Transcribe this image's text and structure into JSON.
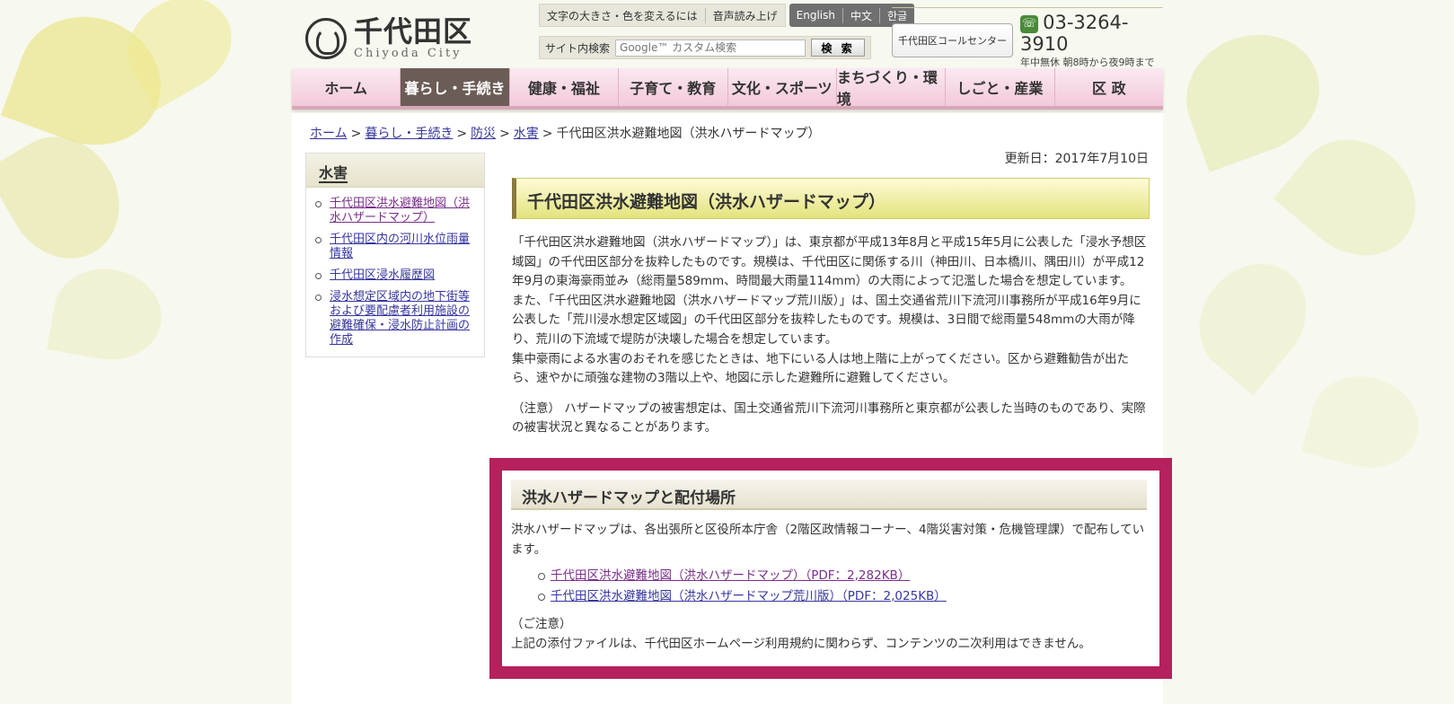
{
  "header": {
    "logo_name": "千代田区",
    "logo_sub": "Chiyoda City",
    "util_font": "文字の大きさ・色を変えるには",
    "util_voice": "音声読み上げ",
    "lang_en": "English",
    "lang_zh": "中文",
    "lang_ko": "한글",
    "search_label": "サイト内検索",
    "search_placeholder": "Google™ カスタム検索",
    "search_button": "検 索",
    "call_center": "千代田区コールセンター",
    "call_number": "03-3264-3910",
    "call_note": "年中無休  朝8時から夜9時まで"
  },
  "nav": {
    "items": [
      "ホーム",
      "暮らし・手続き",
      "健康・福祉",
      "子育て・教育",
      "文化・スポーツ",
      "まちづくり・環境",
      "しごと・産業",
      "区 政"
    ]
  },
  "breadcrumb": {
    "items": [
      "ホーム",
      "暮らし・手続き",
      "防災",
      "水害"
    ],
    "current": "千代田区洪水避難地図（洪水ハザードマップ）"
  },
  "sidebar": {
    "title": "水害",
    "items": [
      "千代田区洪水避難地図（洪水ハザードマップ）",
      "千代田区内の河川水位雨量情報",
      "千代田区浸水履歴図",
      "浸水想定区域内の地下街等および要配慮者利用施設の避難確保・浸水防止計画の作成"
    ]
  },
  "main": {
    "updated": "更新日：2017年7月10日",
    "title": "千代田区洪水避難地図（洪水ハザードマップ）",
    "paragraphs": [
      "「千代田区洪水避難地図（洪水ハザードマップ）」は、東京都が平成13年8月と平成15年5月に公表した「浸水予想区域図」の千代田区部分を抜粋したものです。規模は、千代田区に関係する川（神田川、日本橋川、隅田川）が平成12年9月の東海豪雨並み（総雨量589mm、時間最大雨量114mm）の大雨によって氾濫した場合を想定しています。",
      "また、「千代田区洪水避難地図（洪水ハザードマップ荒川版）」は、国土交通省荒川下流河川事務所が平成16年9月に公表した「荒川浸水想定区域図」の千代田区部分を抜粋したものです。規模は、3日間で総雨量548mmの大雨が降り、荒川の下流域で堤防が決壊した場合を想定しています。",
      "集中豪雨による水害のおそれを感じたときは、地下にいる人は地上階に上がってください。区から避難勧告が出たら、速やかに頑強な建物の3階以上や、地図に示した避難所に避難してください。"
    ],
    "note": "（注意） ハザードマップの被害想定は、国土交通省荒川下流河川事務所と東京都が公表した当時のものであり、実際の被害状況と異なることがあります。"
  },
  "section": {
    "title": "洪水ハザードマップと配付場所",
    "text": "洪水ハザードマップは、各出張所と区役所本庁舎（2階区政情報コーナー、4階災害対策・危機管理課）で配布しています。",
    "files": [
      "千代田区洪水避難地図（洪水ハザードマップ）（PDF：2,282KB）",
      "千代田区洪水避難地図（洪水ハザードマップ荒川版）（PDF：2,025KB）"
    ],
    "caution_title": "（ご注意）",
    "caution_text": "上記の添付ファイルは、千代田区ホームページ利用規約に関わらず、コンテンツの二次利用はできません。"
  },
  "colors": {
    "highlight_border": "#b5215c",
    "nav_active": "#6b5d56",
    "link": "#3636a0"
  }
}
